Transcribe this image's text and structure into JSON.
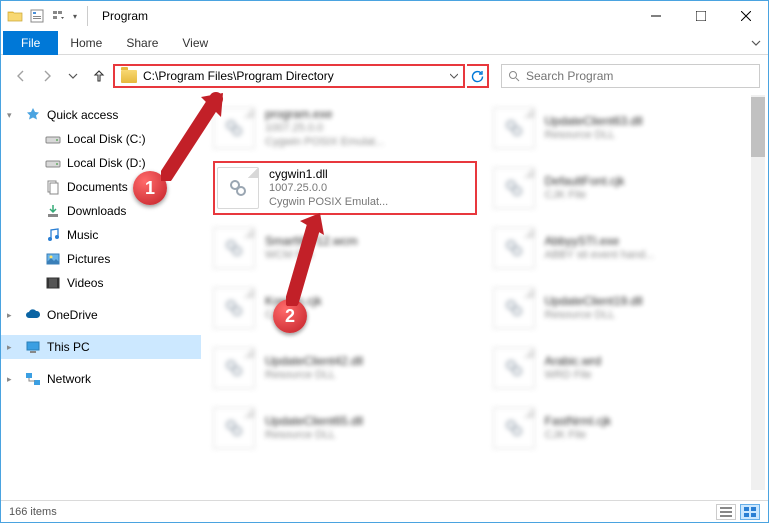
{
  "window": {
    "title": "Program"
  },
  "ribbon": {
    "file": "File",
    "home": "Home",
    "share": "Share",
    "view": "View"
  },
  "nav": {
    "path": "C:\\Program Files\\Program Directory"
  },
  "search": {
    "placeholder": "Search Program"
  },
  "sidebar": {
    "quick": "Quick access",
    "items": [
      {
        "label": "Local Disk (C:)"
      },
      {
        "label": "Local Disk (D:)"
      },
      {
        "label": "Documents"
      },
      {
        "label": "Downloads"
      },
      {
        "label": "Music"
      },
      {
        "label": "Pictures"
      },
      {
        "label": "Videos"
      }
    ],
    "onedrive": "OneDrive",
    "thispc": "This PC",
    "network": "Network"
  },
  "files": [
    {
      "name": "program.exe",
      "line2": "1007.25.0.0",
      "line3": "Cygwin POSIX Emulat..."
    },
    {
      "name": "UpdateClient63.dll",
      "line2": "Resource DLL",
      "line3": ""
    },
    {
      "name": "cygwin1.dll",
      "line2": "1007.25.0.0",
      "line3": "Cygwin POSIX Emulat..."
    },
    {
      "name": "DefaultFont.cjk",
      "line2": "CJK File",
      "line3": ""
    },
    {
      "name": "SmartWP12.wcm",
      "line2": "WCM File",
      "line3": ""
    },
    {
      "name": "AbbyySTI.exe",
      "line2": "ABBY sti event hand...",
      "line3": ""
    },
    {
      "name": "Korean.cjk",
      "line2": "CJK File",
      "line3": ""
    },
    {
      "name": "UpdateClient19.dll",
      "line2": "Resource DLL",
      "line3": ""
    },
    {
      "name": "UpdateClient42.dll",
      "line2": "Resource DLL",
      "line3": ""
    },
    {
      "name": "Arabic.wrd",
      "line2": "WRD File",
      "line3": ""
    },
    {
      "name": "UpdateClient65.dll",
      "line2": "Resource DLL",
      "line3": ""
    },
    {
      "name": "FastNrml.cjk",
      "line2": "CJK File",
      "line3": ""
    }
  ],
  "status": {
    "count": "166 items"
  },
  "callouts": {
    "one": "1",
    "two": "2"
  }
}
